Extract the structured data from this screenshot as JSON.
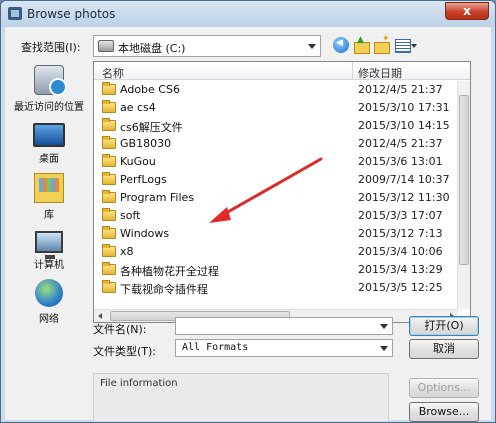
{
  "window": {
    "title": "Browse photos",
    "close_label": "x"
  },
  "lookin": {
    "label": "查找范围(I):",
    "value": "本地磁盘 (C:)"
  },
  "places": [
    {
      "label": "最近访问的位置",
      "icon": "recent-places-icon"
    },
    {
      "label": "桌面",
      "icon": "desktop-icon"
    },
    {
      "label": "库",
      "icon": "libraries-icon"
    },
    {
      "label": "计算机",
      "icon": "computer-icon"
    },
    {
      "label": "网络",
      "icon": "network-icon"
    }
  ],
  "columns": {
    "name": "名称",
    "date": "修改日期"
  },
  "files": [
    {
      "name": "Adobe CS6",
      "date": "2012/4/5 21:37"
    },
    {
      "name": "ae cs4",
      "date": "2015/3/10 17:31"
    },
    {
      "name": "cs6解压文件",
      "date": "2015/3/10 14:15"
    },
    {
      "name": "GB18030",
      "date": "2012/4/5 21:37"
    },
    {
      "name": "KuGou",
      "date": "2015/3/6 13:01"
    },
    {
      "name": "PerfLogs",
      "date": "2009/7/14 10:37"
    },
    {
      "name": "Program Files",
      "date": "2015/3/12 11:30"
    },
    {
      "name": "soft",
      "date": "2015/3/3 17:07"
    },
    {
      "name": "Windows",
      "date": "2015/3/12 7:13"
    },
    {
      "name": "x8",
      "date": "2015/3/4 10:06"
    },
    {
      "name": "各种植物花开全过程",
      "date": "2015/3/4 13:29"
    },
    {
      "name": "下载视命令插件程",
      "date": "2015/3/5 12:25"
    }
  ],
  "form": {
    "filename_label": "文件名(N):",
    "filename_value": "",
    "filetype_label": "文件类型(T):",
    "filetype_value": "All Formats"
  },
  "buttons": {
    "open": "打开(O)",
    "cancel": "取消",
    "options": "Options...",
    "browse": "Browse..."
  },
  "info": {
    "label": "File information"
  },
  "colors": {
    "annotation_arrow": "#e02a2a",
    "window_frame": "#c9daea"
  }
}
